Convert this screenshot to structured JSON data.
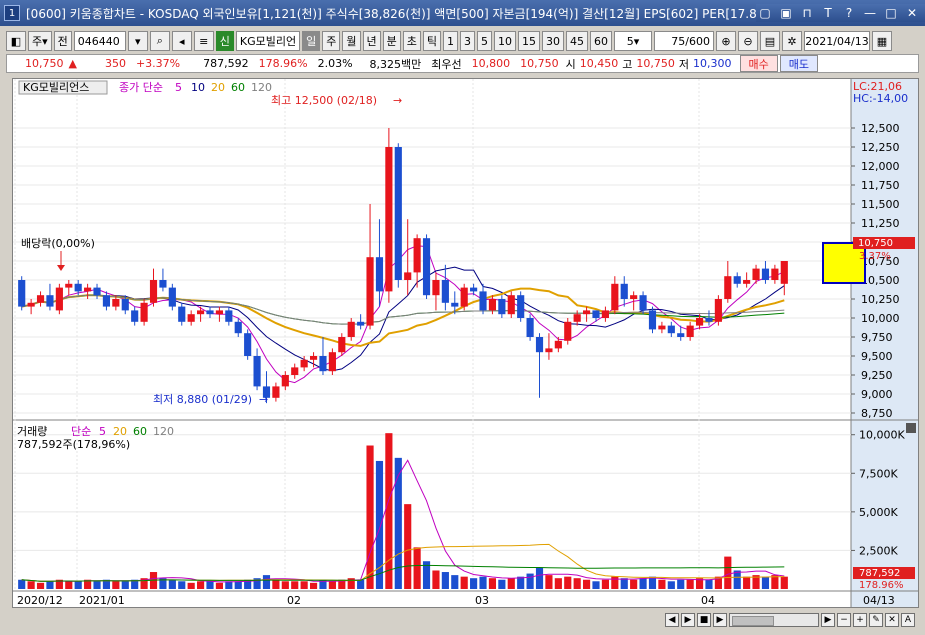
{
  "window": {
    "icon": "1",
    "title": "[0600] 키움종합차트 - KOSDAQ 외국인보유[1,121(천)] 주식수[38,826(천)] 액면[500] 자본금[194(억)] 결산[12월] EPS[602] PER[17.8",
    "buttons": [
      "▢",
      "▣",
      "⊓",
      "T",
      "?",
      "—",
      "□",
      "✕"
    ]
  },
  "toolbar": {
    "period_sel": "주",
    "mode": "전",
    "code": "046440",
    "shin": "신",
    "name": "KG모빌리언",
    "intervals": [
      "일",
      "주",
      "월",
      "년",
      "분",
      "초",
      "틱"
    ],
    "selected_interval": "일",
    "minutes": [
      "1",
      "3",
      "5",
      "10",
      "15",
      "30",
      "45",
      "60"
    ],
    "min_sel": "5",
    "count": "75/600",
    "date": "2021/04/13"
  },
  "quote": {
    "price": "10,750",
    "arrow": "▲",
    "change": "350",
    "rate": "+3.37%",
    "volume": "787,592",
    "vol_rate": "178.96%",
    "turnover": "2.03%",
    "amount": "8,325백만",
    "best": "최우선",
    "ask": "10,800",
    "bid": "10,750",
    "open_label": "시",
    "open": "10,450",
    "high_label": "고",
    "high": "10,750",
    "low_label": "저",
    "low": "10,300",
    "buy": "매수",
    "sell": "매도"
  },
  "price_panel": {
    "name": "KG모빌리언스",
    "ma_label": "종가 단순",
    "ma": [
      "5",
      "10",
      "20",
      "60",
      "120"
    ],
    "ma_colors": [
      "#c000c0",
      "#000080",
      "#e0a000",
      "#008000",
      "#808080"
    ],
    "lc": "LC:21,06",
    "hc": "HC:-14,00",
    "high_note": "최고 12,500 (02/18)",
    "low_note": "최저 8,880 (01/29)",
    "div_note": "배당락(0,00%)",
    "current_label": "10,750",
    "current_rate": "3.37%",
    "y_ticks": [
      "12,500",
      "12,250",
      "12,000",
      "11,750",
      "11,500",
      "11,250",
      "11,000",
      "10,750",
      "10,500",
      "10,250",
      "10,000",
      "9,750",
      "9,500",
      "9,250",
      "9,000",
      "8,750"
    ]
  },
  "volume_panel": {
    "name": "거래량",
    "ma_label": "단순",
    "ma": [
      "5",
      "20",
      "60",
      "120"
    ],
    "value": "787,592주(178,96%)",
    "current": "787,592",
    "current_rate": "178.96%",
    "y_ticks": [
      "10,000K",
      "7,500K",
      "5,000K",
      "2,500K"
    ]
  },
  "x_axis": [
    "2020/12",
    "2021/01",
    "02",
    "03",
    "04",
    "04/13"
  ],
  "chart_data": {
    "type": "candlestick",
    "x_labels": [
      "2020/12",
      "2021/01",
      "02",
      "03",
      "04"
    ],
    "candles": [
      [
        10500,
        10550,
        10100,
        10150
      ],
      [
        10150,
        10250,
        10050,
        10200
      ],
      [
        10200,
        10350,
        10150,
        10300
      ],
      [
        10300,
        10450,
        10100,
        10150
      ],
      [
        10100,
        10450,
        10050,
        10400
      ],
      [
        10400,
        10500,
        10300,
        10450
      ],
      [
        10450,
        10500,
        10300,
        10350
      ],
      [
        10350,
        10450,
        10250,
        10400
      ],
      [
        10400,
        10450,
        10250,
        10300
      ],
      [
        10300,
        10350,
        10100,
        10150
      ],
      [
        10150,
        10300,
        10100,
        10250
      ],
      [
        10250,
        10300,
        10050,
        10100
      ],
      [
        10100,
        10150,
        9900,
        9950
      ],
      [
        9950,
        10250,
        9900,
        10200
      ],
      [
        10200,
        10650,
        10150,
        10500
      ],
      [
        10500,
        10650,
        10350,
        10400
      ],
      [
        10400,
        10450,
        10100,
        10150
      ],
      [
        10150,
        10200,
        9900,
        9950
      ],
      [
        9950,
        10100,
        9900,
        10050
      ],
      [
        10050,
        10150,
        9950,
        10100
      ],
      [
        10100,
        10150,
        10000,
        10050
      ],
      [
        10050,
        10150,
        9950,
        10100
      ],
      [
        10100,
        10150,
        9900,
        9950
      ],
      [
        9950,
        10000,
        9750,
        9800
      ],
      [
        9800,
        9850,
        9450,
        9500
      ],
      [
        9500,
        9600,
        9050,
        9100
      ],
      [
        9100,
        9300,
        8880,
        8950
      ],
      [
        8950,
        9150,
        8900,
        9100
      ],
      [
        9100,
        9300,
        9050,
        9250
      ],
      [
        9250,
        9400,
        9200,
        9350
      ],
      [
        9350,
        9500,
        9300,
        9450
      ],
      [
        9450,
        9550,
        9350,
        9500
      ],
      [
        9500,
        9750,
        9250,
        9300
      ],
      [
        9300,
        9600,
        9250,
        9550
      ],
      [
        9550,
        9800,
        9500,
        9750
      ],
      [
        9750,
        10000,
        9700,
        9950
      ],
      [
        9950,
        10050,
        9850,
        9900
      ],
      [
        9900,
        11500,
        9850,
        10800
      ],
      [
        10800,
        11300,
        10150,
        10350
      ],
      [
        10350,
        12500,
        10200,
        12250
      ],
      [
        12250,
        12300,
        10400,
        10500
      ],
      [
        10500,
        11300,
        10300,
        10600
      ],
      [
        10600,
        11100,
        10400,
        11050
      ],
      [
        11050,
        11100,
        10250,
        10300
      ],
      [
        10300,
        10600,
        10100,
        10500
      ],
      [
        10500,
        10700,
        10100,
        10200
      ],
      [
        10200,
        10350,
        10050,
        10150
      ],
      [
        10150,
        10450,
        10100,
        10400
      ],
      [
        10400,
        10450,
        10300,
        10350
      ],
      [
        10350,
        10450,
        10050,
        10100
      ],
      [
        10100,
        10300,
        10050,
        10250
      ],
      [
        10250,
        10300,
        10000,
        10050
      ],
      [
        10050,
        10350,
        10000,
        10300
      ],
      [
        10300,
        10350,
        9950,
        10000
      ],
      [
        10000,
        10050,
        9700,
        9750
      ],
      [
        9750,
        9800,
        8950,
        9550
      ],
      [
        9550,
        9800,
        9450,
        9600
      ],
      [
        9600,
        9750,
        9550,
        9700
      ],
      [
        9700,
        10000,
        9650,
        9950
      ],
      [
        9950,
        10100,
        9900,
        10050
      ],
      [
        10050,
        10150,
        9950,
        10100
      ],
      [
        10100,
        10100,
        9950,
        10000
      ],
      [
        10000,
        10150,
        9950,
        10100
      ],
      [
        10100,
        10550,
        10050,
        10450
      ],
      [
        10450,
        10550,
        10150,
        10250
      ],
      [
        10250,
        10350,
        10100,
        10300
      ],
      [
        10300,
        10350,
        10050,
        10100
      ],
      [
        10100,
        10150,
        9800,
        9850
      ],
      [
        9850,
        9950,
        9800,
        9900
      ],
      [
        9900,
        9950,
        9750,
        9800
      ],
      [
        9800,
        9900,
        9700,
        9750
      ],
      [
        9750,
        9950,
        9700,
        9900
      ],
      [
        9900,
        10050,
        9850,
        10000
      ],
      [
        10000,
        10100,
        9900,
        9950
      ],
      [
        9950,
        10300,
        9900,
        10250
      ],
      [
        10250,
        10750,
        10200,
        10550
      ],
      [
        10550,
        10600,
        10400,
        10450
      ],
      [
        10450,
        10600,
        10400,
        10500
      ],
      [
        10500,
        10700,
        10450,
        10650
      ],
      [
        10650,
        10750,
        10450,
        10500
      ],
      [
        10500,
        10700,
        10450,
        10650
      ],
      [
        10450,
        10750,
        10300,
        10750
      ]
    ],
    "volumes": [
      0.6,
      0.5,
      0.4,
      0.5,
      0.6,
      0.5,
      0.5,
      0.6,
      0.5,
      0.6,
      0.5,
      0.5,
      0.6,
      0.7,
      1.1,
      0.7,
      0.6,
      0.5,
      0.4,
      0.5,
      0.5,
      0.4,
      0.5,
      0.5,
      0.6,
      0.7,
      0.9,
      0.6,
      0.5,
      0.5,
      0.5,
      0.4,
      0.6,
      0.5,
      0.6,
      0.7,
      0.6,
      9.3,
      8.3,
      10.1,
      8.5,
      5.5,
      2.7,
      1.8,
      1.2,
      1.1,
      0.9,
      0.8,
      0.7,
      0.8,
      0.7,
      0.6,
      0.7,
      0.8,
      1.0,
      1.4,
      0.9,
      0.7,
      0.8,
      0.7,
      0.6,
      0.5,
      0.6,
      0.8,
      0.7,
      0.6,
      0.7,
      0.8,
      0.6,
      0.5,
      0.6,
      0.6,
      0.7,
      0.6,
      0.8,
      2.1,
      1.2,
      0.8,
      0.9,
      0.8,
      0.9,
      0.8
    ],
    "volume_unit": "M",
    "price_range": [
      8750,
      12750
    ],
    "volume_range": [
      0,
      10500
    ]
  }
}
